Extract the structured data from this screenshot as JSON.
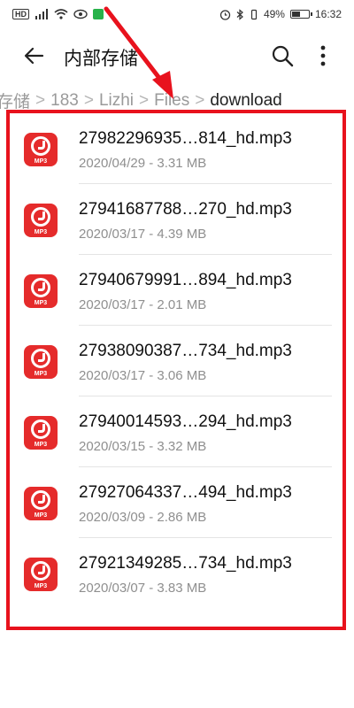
{
  "status_bar": {
    "hd_label": "HD",
    "battery_percent": "49%",
    "battery_level": 0.49,
    "time": "16:32"
  },
  "header": {
    "title": "内部存储"
  },
  "breadcrumb": {
    "items": [
      "存储",
      "183",
      "Lizhi"
    ],
    "files": "Files",
    "current": "download",
    "separator": ">"
  },
  "files": [
    {
      "name": "27982296935…814_hd.mp3",
      "date": "2020/04/29",
      "size": "3.31 MB",
      "meta": "2020/04/29 - 3.31 MB"
    },
    {
      "name": "27941687788…270_hd.mp3",
      "date": "2020/03/17",
      "size": "4.39 MB",
      "meta": "2020/03/17 - 4.39 MB"
    },
    {
      "name": "27940679991…894_hd.mp3",
      "date": "2020/03/17",
      "size": "2.01 MB",
      "meta": "2020/03/17 - 2.01 MB"
    },
    {
      "name": "27938090387…734_hd.mp3",
      "date": "2020/03/17",
      "size": "3.06 MB",
      "meta": "2020/03/17 - 3.06 MB"
    },
    {
      "name": "27940014593…294_hd.mp3",
      "date": "2020/03/15",
      "size": "3.32 MB",
      "meta": "2020/03/15 - 3.32 MB"
    },
    {
      "name": "27927064337…494_hd.mp3",
      "date": "2020/03/09",
      "size": "2.86 MB",
      "meta": "2020/03/09 - 2.86 MB"
    },
    {
      "name": "27921349285…734_hd.mp3",
      "date": "2020/03/07",
      "size": "3.83 MB",
      "meta": "2020/03/07 - 3.83 MB"
    }
  ],
  "file_icon_label": "MP3",
  "colors": {
    "highlight": "#e8121d",
    "file_icon": "#e52b2b",
    "status_green": "#27b24a"
  }
}
